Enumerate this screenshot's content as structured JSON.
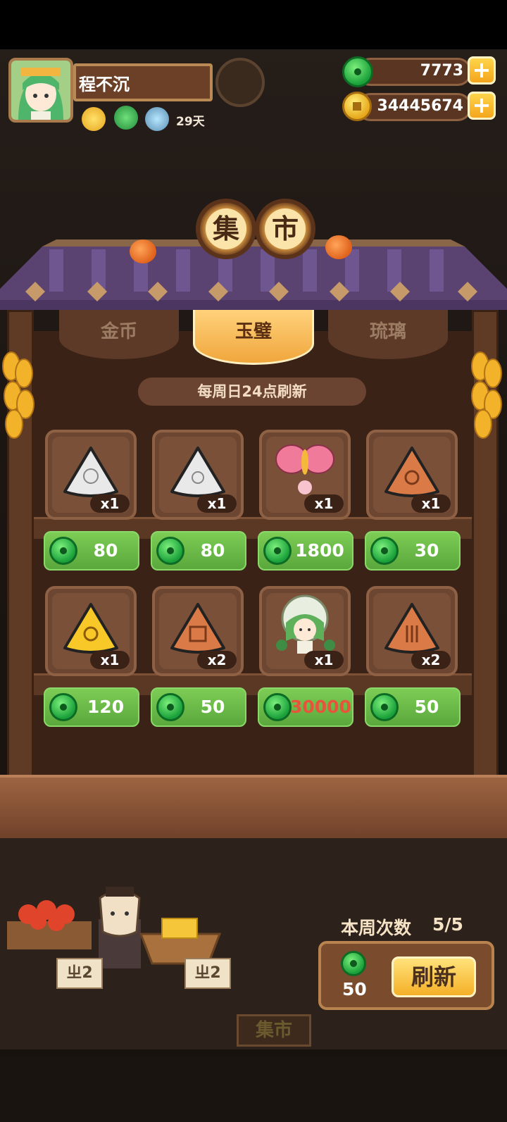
{
  "player": {
    "name": "程不沉",
    "days": "29天"
  },
  "currency": {
    "jade": "7773",
    "gold": "34445674"
  },
  "market": {
    "title_chars": [
      "集",
      "市"
    ],
    "tabs": [
      "金币",
      "玉璧",
      "琉璃"
    ],
    "active_tab": "玉璧",
    "refresh_note": "每周日24点刷新"
  },
  "items": [
    {
      "name": "white-rice-dumpling-crab",
      "qty": "x1",
      "price": "80",
      "price_color": "#ffffff"
    },
    {
      "name": "white-rice-dumpling-flower",
      "qty": "x1",
      "price": "80",
      "price_color": "#ffffff"
    },
    {
      "name": "pink-butterfly",
      "qty": "x1",
      "price": "1800",
      "price_color": "#ffffff"
    },
    {
      "name": "brown-rice-dumpling-swirl",
      "qty": "x1",
      "price": "30",
      "price_color": "#ffffff"
    },
    {
      "name": "gold-rice-dumpling",
      "qty": "x1",
      "price": "120",
      "price_color": "#ffffff"
    },
    {
      "name": "brown-rice-dumpling-glyph",
      "qty": "x2",
      "price": "50",
      "price_color": "#ffffff"
    },
    {
      "name": "green-hair-character",
      "qty": "x1",
      "price": "30000",
      "price_color": "#e8533c"
    },
    {
      "name": "brown-rice-dumpling-lines",
      "qty": "x2",
      "price": "50",
      "price_color": "#ffffff"
    }
  ],
  "weekly": {
    "label": "本周次数",
    "value": "5/5"
  },
  "refresh": {
    "cost": "50",
    "button_label": "刷新"
  },
  "bottom_sign": "集市",
  "tags": [
    "ㄓ2",
    "ㄓ2"
  ]
}
